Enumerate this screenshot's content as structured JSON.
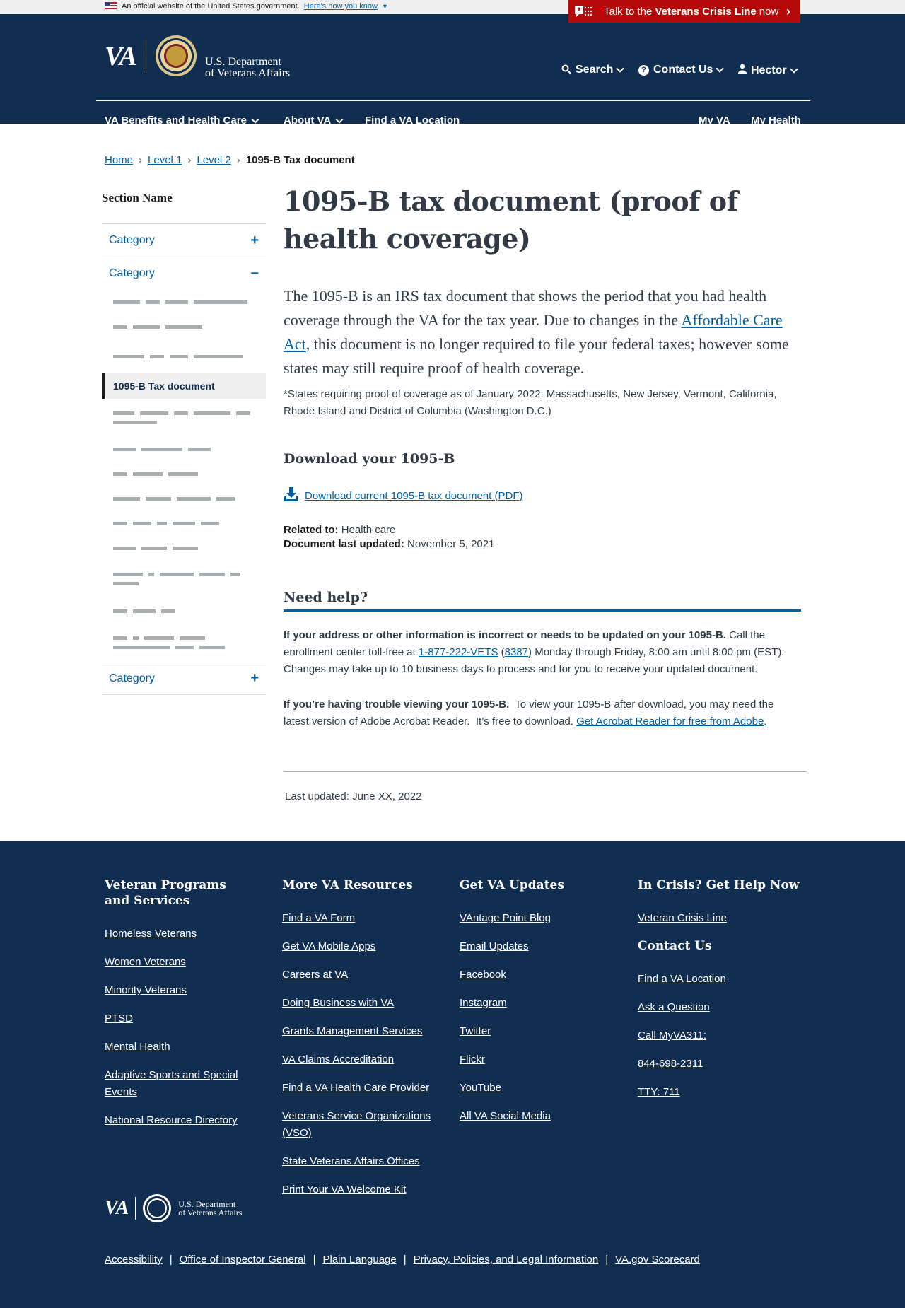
{
  "official": {
    "text": "An official website of the United States government.",
    "link": "Here's how you know"
  },
  "crisis": {
    "pre": "Talk to the",
    "bold": "Veterans Crisis Line",
    "post": "now"
  },
  "header": {
    "logo": "VA",
    "dept_line1": "U.S. Department",
    "dept_line2": "of Veterans Affairs",
    "search": "Search",
    "contact": "Contact Us",
    "user": "Hector",
    "nav": [
      "VA Benefits and Health Care",
      "About VA",
      "Find a VA Location"
    ],
    "right_nav": [
      "My VA",
      "My Health"
    ]
  },
  "breadcrumb": [
    "Home",
    "Level 1",
    "Level 2",
    "1095-B Tax document"
  ],
  "sidenav": {
    "title": "Section Name",
    "categories": [
      "Category",
      "Category",
      "Category"
    ],
    "active_item": "1095-B Tax document"
  },
  "main": {
    "title": "1095-B tax document (proof of health coverage)",
    "intro_pre": "The 1095-B is an IRS tax document that shows the period that you had health coverage through the VA for the tax year. Due to changes in the ",
    "intro_link": "Affordable Care Act",
    "intro_post": ", this document is no longer required to file your federal taxes; however some states may still require proof of health coverage.",
    "note": "*States requiring proof of coverage as of January 2022: Massachusetts, New Jersey, Vermont, California, Rhode Island and District of Columbia (Washington D.C.)",
    "download_heading": "Download your 1095-B",
    "download_link": "Download current 1095-B tax document (PDF)",
    "related_label": "Related to:",
    "related_value": "Health care",
    "updated_label": "Document last updated:",
    "updated_value": "November 5, 2021",
    "help_heading": "Need help?",
    "help1_bold": "If your address or other information is incorrect or needs to be updated on your 1095-B.",
    "help1_a": " Call the enrollment center toll-free at ",
    "help1_phone": "1-877-222-VETS",
    "help1_b": " (",
    "help1_tty": "8387",
    "help1_c": ") Monday through Friday, 8:00 am until 8:00 pm (EST). Changes may take up to 10 business days to process and for you to receive your updated document.",
    "help2_bold": "If you’re having trouble viewing your 1095-B.",
    "help2_a": "  To view your 1095-B after download, you may need the latest version of Adobe Acrobat Reader.  It’s free to download. ",
    "help2_link": "Get Acrobat Reader for free from Adobe",
    "help2_b": ".",
    "last_updated": "Last updated: June XX, 2022"
  },
  "footer": {
    "col1_title": "Veteran Programs and Services",
    "col1": [
      "Homeless Veterans",
      "Women Veterans",
      "Minority Veterans",
      "PTSD",
      "Mental Health",
      "Adaptive Sports and Special Events",
      "National Resource Directory"
    ],
    "col2_title": "More VA Resources",
    "col2": [
      "Find a VA Form",
      "Get VA Mobile Apps",
      "Careers at VA",
      "Doing Business with VA",
      "Grants Management Services",
      "VA Claims Accreditation",
      "Find a VA Health Care Provider",
      "Veterans Service Organizations (VSO)",
      "State Veterans Affairs Offices",
      "Print Your VA Welcome Kit"
    ],
    "col3_title": "Get VA Updates",
    "col3": [
      "VAntage Point Blog",
      "Email Updates",
      "Facebook",
      "Instagram",
      "Twitter",
      "Flickr",
      "YouTube",
      "All VA Social Media"
    ],
    "col4_title": "In Crisis? Get Help Now",
    "col4": [
      "Veteran Crisis Line"
    ],
    "col4b_title": "Contact Us",
    "col4b": [
      "Find a VA Location",
      "Ask a Question",
      "Call MyVA311:",
      "844-698-2311",
      "TTY: 711"
    ],
    "logo": "VA",
    "dept_line1": "U.S. Department",
    "dept_line2": "of Veterans Affairs",
    "bottom": [
      "Accessibility",
      "Office of Inspector General",
      "Plain Language",
      "Privacy, Policies, and Legal Information",
      "VA.gov Scorecard"
    ],
    "sep": "|"
  }
}
